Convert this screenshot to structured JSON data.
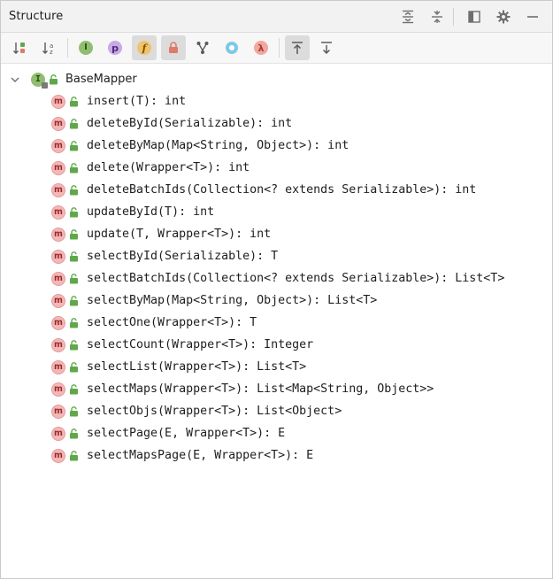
{
  "panel": {
    "title": "Structure"
  },
  "title_actions": [
    {
      "name": "expand-all-icon"
    },
    {
      "name": "collapse-all-icon"
    },
    {
      "name": "layout-icon"
    },
    {
      "name": "gear-icon"
    },
    {
      "name": "minimize-icon"
    }
  ],
  "toolbar": [
    {
      "name": "sort-by-visibility-icon",
      "active": false
    },
    {
      "name": "sort-alphabetically-icon",
      "active": false
    },
    {
      "name": "show-inherited-icon",
      "active": false
    },
    {
      "name": "show-properties-icon",
      "active": false,
      "glyph": "p"
    },
    {
      "name": "show-fields-icon",
      "active": true,
      "glyph": "f"
    },
    {
      "name": "show-non-public-icon",
      "active": true
    },
    {
      "name": "show-hierarchy-icon",
      "active": false
    },
    {
      "name": "show-anonymous-icon",
      "active": false
    },
    {
      "name": "show-lambdas-icon",
      "active": false,
      "glyph": "λ"
    },
    {
      "name": "autoscroll-to-source-icon",
      "active": true
    },
    {
      "name": "autoscroll-from-source-icon",
      "active": false
    }
  ],
  "tree": {
    "root": {
      "label": "BaseMapper",
      "badge": "I",
      "expanded": true
    },
    "method_badge": "m",
    "methods": [
      "insert(T): int",
      "deleteById(Serializable): int",
      "deleteByMap(Map<String, Object>): int",
      "delete(Wrapper<T>): int",
      "deleteBatchIds(Collection<? extends Serializable>): int",
      "updateById(T): int",
      "update(T, Wrapper<T>): int",
      "selectById(Serializable): T",
      "selectBatchIds(Collection<? extends Serializable>): List<T>",
      "selectByMap(Map<String, Object>): List<T>",
      "selectOne(Wrapper<T>): T",
      "selectCount(Wrapper<T>): Integer",
      "selectList(Wrapper<T>): List<T>",
      "selectMaps(Wrapper<T>): List<Map<String, Object>>",
      "selectObjs(Wrapper<T>): List<Object>",
      "selectPage(E, Wrapper<T>): E",
      "selectMapsPage(E, Wrapper<T>): E"
    ]
  },
  "colors": {
    "method_badge_bg": "#f3b7b7",
    "method_badge_fg": "#9c2b2b",
    "interface_badge_bg": "#8fbf6e",
    "lock_green": "#5fa84a"
  }
}
